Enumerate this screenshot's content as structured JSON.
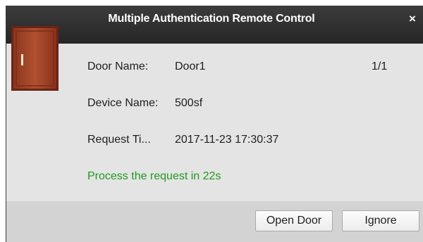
{
  "dialog": {
    "title": "Multiple Authentication Remote Control",
    "close_glyph": "×"
  },
  "details": {
    "door_name_label": "Door Name:",
    "door_name_value": "Door1",
    "device_name_label": "Device Name:",
    "device_name_value": "500sf",
    "request_time_label": "Request Ti...",
    "request_time_value": "2017-11-23 17:30:37",
    "counter": "1/1"
  },
  "status_message": "Process the request in 22s",
  "buttons": {
    "open_door": "Open Door",
    "ignore": "Ignore"
  },
  "icons": {
    "door": "door-icon",
    "close": "close-icon"
  },
  "colors": {
    "titlebar": "#2e2e2e",
    "status_text": "#1f9a1f",
    "door": "#a0452a"
  }
}
